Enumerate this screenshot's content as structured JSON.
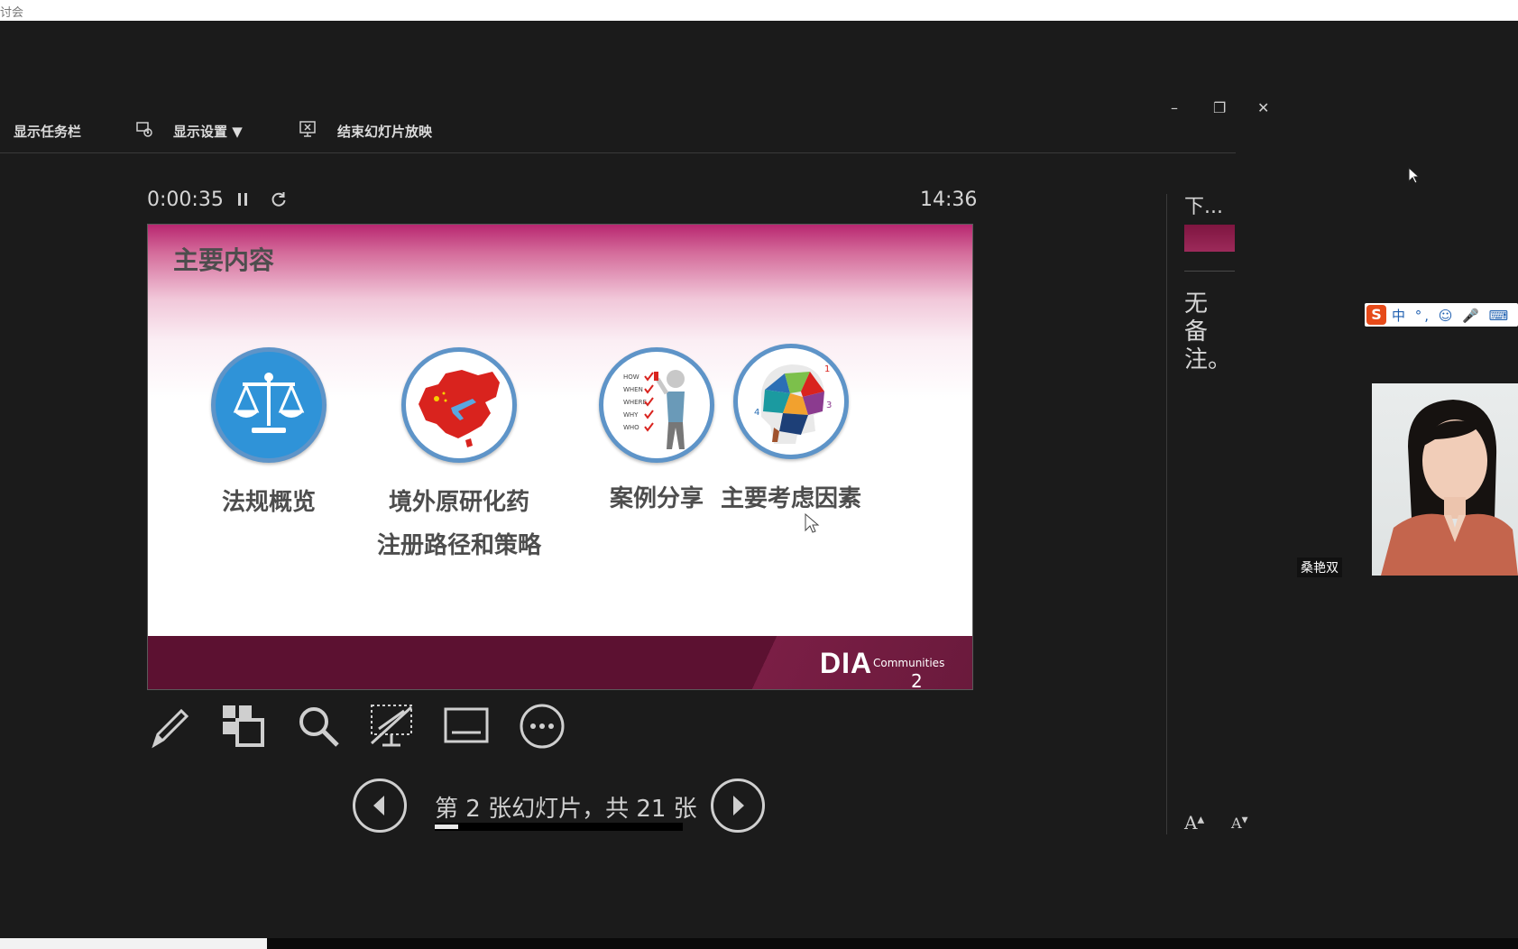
{
  "window": {
    "title": "讨会"
  },
  "toolbar": {
    "show_taskbar": "显示任务栏",
    "display_settings": "显示设置 ▼",
    "end_slideshow": "结束幻灯片放映"
  },
  "window_controls": {
    "minimize": "–",
    "restore": "❐",
    "close": "✕"
  },
  "presenter": {
    "elapsed_time": "0:00:35",
    "clock": "14:36",
    "slide_counter": "第 2 张幻灯片，共 21 张",
    "progress_fraction": 0.095
  },
  "slide": {
    "title": "主要内容",
    "topics": [
      {
        "label": "法规概览"
      },
      {
        "label_line1": "境外原研化药",
        "label_line2": "注册路径和策略"
      },
      {
        "label": "案例分享"
      },
      {
        "label": "主要考虑因素"
      }
    ],
    "checklist": [
      "HOW",
      "WHEN",
      "WHERE",
      "WHY",
      "WHO"
    ],
    "footer_logo": "DIA",
    "footer_sub": "Communities",
    "number": "2"
  },
  "next_panel": {
    "label": "下...",
    "notes": "无备注。"
  },
  "ime": {
    "logo": "S",
    "icons": "中 °, ☺ 🎤 ⌨ 👕 ⚙"
  },
  "webcam": {
    "name": "桑艳双"
  },
  "colors": {
    "slide_footer": "#5c1131",
    "slide_accent": "#b82770",
    "circle_border": "#5e94c8",
    "background": "#1b1b1b"
  }
}
